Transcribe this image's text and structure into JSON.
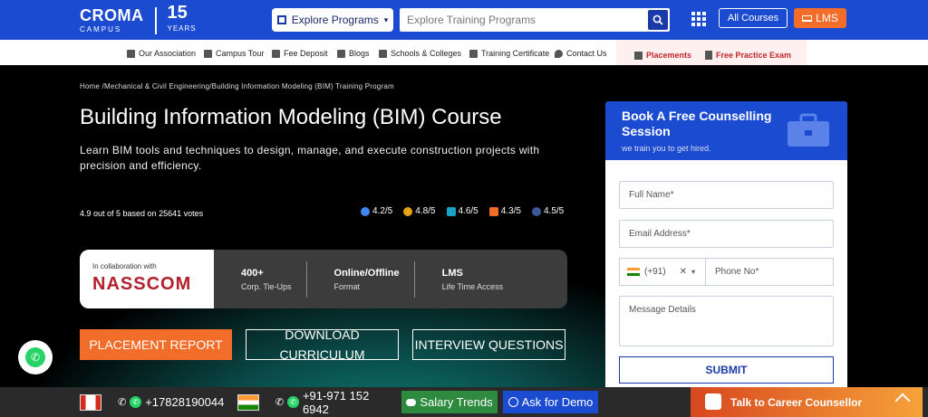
{
  "header": {
    "logo_name": "CROMA",
    "logo_sub": "CAMPUS",
    "logo_years": "15",
    "logo_years_label": "YEARS",
    "explore_label": "Explore Programs",
    "search_placeholder": "Explore Training Programs",
    "all_courses_label": "All Courses",
    "lms_label": "LMS"
  },
  "subnav": {
    "items": [
      {
        "label": "Our Association",
        "icon": "association-icon"
      },
      {
        "label": "Campus Tour",
        "icon": "building-icon"
      },
      {
        "label": "Fee Deposit",
        "icon": "card-icon"
      },
      {
        "label": "Blogs",
        "icon": "rss-icon"
      },
      {
        "label": "Schools & Colleges",
        "icon": "school-icon"
      },
      {
        "label": "Training Certificate",
        "icon": "certificate-icon"
      },
      {
        "label": "Contact Us",
        "icon": "location-icon"
      }
    ],
    "placements_label": "Placements",
    "practice_exam_label": "Free Practice Exam"
  },
  "hero": {
    "breadcrumb": "Home /Mechanical & Civil Engineering/Building Information Modeling (BIM) Training Program",
    "title": "Building Information Modeling (BIM) Course",
    "subtitle": "Learn BIM tools and techniques to design, manage, and execute construction projects with precision and efficiency.",
    "rating_text": "4.9 out of 5 based on 25641 votes",
    "ratings": [
      {
        "value": "4.2/5",
        "color": "#4285f4"
      },
      {
        "value": "4.8/5",
        "color": "#e8a21a"
      },
      {
        "value": "4.6/5",
        "color": "#1aa3c8"
      },
      {
        "value": "4.3/5",
        "color": "#f26c2a"
      },
      {
        "value": "4.5/5",
        "color": "#3b5998"
      }
    ],
    "collab_small": "In collaboration with",
    "collab_brand": "NASSCOM",
    "stats": [
      {
        "value": "400+",
        "label": "Corp. Tie-Ups"
      },
      {
        "value": "Online/Offline",
        "label": "Format"
      },
      {
        "value": "LMS",
        "label": "Life Time Access"
      }
    ],
    "cta_placement": "PLACEMENT REPORT",
    "cta_download": "DOWNLOAD CURRICULUM",
    "cta_interview": "INTERVIEW QUESTIONS"
  },
  "form": {
    "title": "Book A Free Counselling Session",
    "tagline": "we train you to get hired.",
    "name_placeholder": "Full Name*",
    "email_placeholder": "Email Address*",
    "country_code": "(+91)",
    "phone_placeholder": "Phone No*",
    "message_placeholder": "Message Details",
    "submit_label": "SUBMIT"
  },
  "bottom": {
    "phone1": "+17828190044",
    "phone2": "+91-971 152 6942",
    "salary_label": "Salary Trends",
    "demo_label": "Ask for Demo",
    "career_label": "Talk to Career Counsellor"
  },
  "colors": {
    "brand_blue": "#1a4bd1",
    "accent_orange": "#f26c2a"
  }
}
